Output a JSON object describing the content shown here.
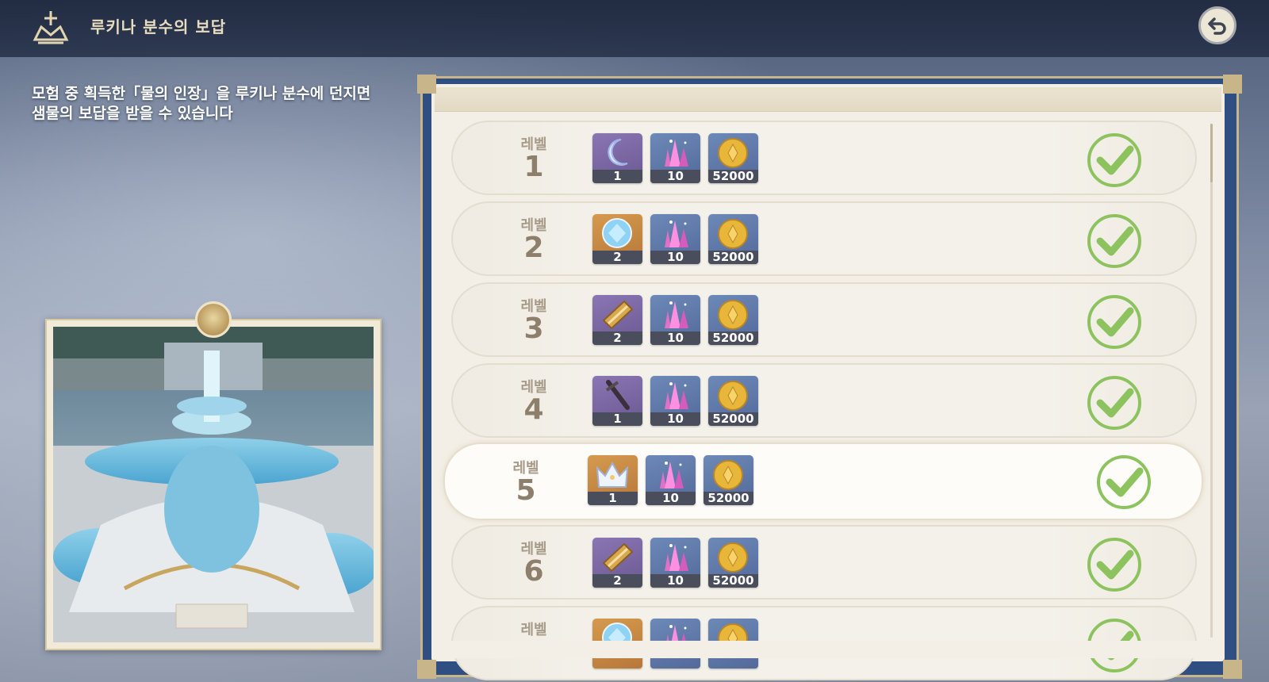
{
  "header": {
    "title": "루키나 분수의 보답"
  },
  "description": {
    "line1": "모험 중 획득한「물의 인장」을 루키나 분수에 던지면",
    "line2": "샘물의 보답을 받을 수 있습니다"
  },
  "levels": [
    {
      "label": "레벨",
      "number": "1",
      "items": [
        {
          "icon": "moon-icon",
          "count": "1",
          "rarity": "purple"
        },
        {
          "icon": "crystal-icon",
          "count": "10",
          "rarity": "blue"
        },
        {
          "icon": "mora-coin-icon",
          "count": "52000",
          "rarity": "blue"
        }
      ],
      "claimed": true
    },
    {
      "label": "레벨",
      "number": "2",
      "items": [
        {
          "icon": "crystal-ball-icon",
          "count": "2",
          "rarity": "gold"
        },
        {
          "icon": "crystal-icon",
          "count": "10",
          "rarity": "blue"
        },
        {
          "icon": "mora-coin-icon",
          "count": "52000",
          "rarity": "blue"
        }
      ],
      "claimed": true
    },
    {
      "label": "레벨",
      "number": "3",
      "items": [
        {
          "icon": "scroll-icon",
          "count": "2",
          "rarity": "purple"
        },
        {
          "icon": "crystal-icon",
          "count": "10",
          "rarity": "blue"
        },
        {
          "icon": "mora-coin-icon",
          "count": "52000",
          "rarity": "blue"
        }
      ],
      "claimed": true
    },
    {
      "label": "레벨",
      "number": "4",
      "items": [
        {
          "icon": "sword-icon",
          "count": "1",
          "rarity": "purple"
        },
        {
          "icon": "crystal-icon",
          "count": "10",
          "rarity": "blue"
        },
        {
          "icon": "mora-coin-icon",
          "count": "52000",
          "rarity": "blue"
        }
      ],
      "claimed": true
    },
    {
      "label": "레벨",
      "number": "5",
      "items": [
        {
          "icon": "crown-icon",
          "count": "1",
          "rarity": "gold"
        },
        {
          "icon": "crystal-icon",
          "count": "10",
          "rarity": "blue"
        },
        {
          "icon": "mora-coin-icon",
          "count": "52000",
          "rarity": "blue"
        }
      ],
      "claimed": true
    },
    {
      "label": "레벨",
      "number": "6",
      "items": [
        {
          "icon": "scroll-icon",
          "count": "2",
          "rarity": "purple"
        },
        {
          "icon": "crystal-icon",
          "count": "10",
          "rarity": "blue"
        },
        {
          "icon": "mora-coin-icon",
          "count": "52000",
          "rarity": "blue"
        }
      ],
      "claimed": true
    },
    {
      "label": "레벨"
    }
  ],
  "colors": {
    "check": "#8dc35e",
    "panel_border": "#2f4f82",
    "gold_trim": "#c9b58a"
  }
}
